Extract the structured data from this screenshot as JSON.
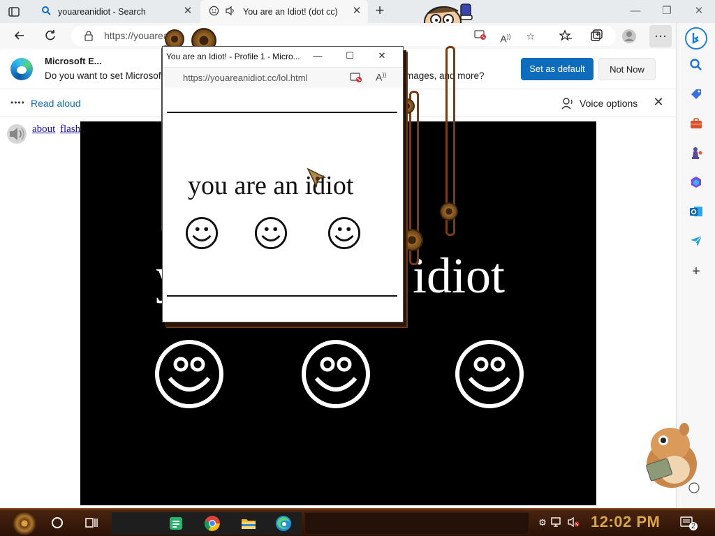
{
  "tabs": [
    {
      "label": "youareanidiot - Search",
      "icon": "search-icon"
    },
    {
      "label": "You are an Idiot! (dot cc)",
      "icon": "sound-icon"
    }
  ],
  "toolbar": {
    "url": "https://youarea",
    "icons": [
      "back-icon",
      "refresh-icon",
      "lock-icon",
      "block-icon",
      "read-aloud-icon",
      "favorite-add-icon",
      "favorites-icon",
      "collections-icon",
      "profile-icon",
      "more-icon"
    ]
  },
  "infobar": {
    "title": "Microsoft E...",
    "text": "Do you want to set Microsoft",
    "text_tail": "images, and more?",
    "set_default": "Set as default",
    "not_now": "Not Now"
  },
  "read_aloud": {
    "label": "Read aloud",
    "voice_options": "Voice options"
  },
  "page": {
    "links": [
      "about",
      "flash"
    ],
    "big_text_left": "y",
    "big_text_right": "idiot",
    "stage_color": "#000000"
  },
  "popup": {
    "title": "You are an Idiot! - Profile 1 - Micro...",
    "url": "https://youareanidiot.cc/lol.html",
    "text": "you are an idiot"
  },
  "sidebar": {
    "icons": [
      "bing-icon",
      "search-icon",
      "shopping-tag-icon",
      "tools-icon",
      "games-icon",
      "office-icon",
      "outlook-icon",
      "send-icon",
      "add-icon"
    ]
  },
  "taskbar": {
    "time": "12:02 PM",
    "notifications": "2",
    "pinned": [
      "notes-app-icon",
      "chrome-icon",
      "file-explorer-icon",
      "edge-icon"
    ]
  },
  "colors": {
    "accent": "#0f6cbd",
    "taskbar": "#3a1a0a",
    "clock": "#d7a54a"
  }
}
